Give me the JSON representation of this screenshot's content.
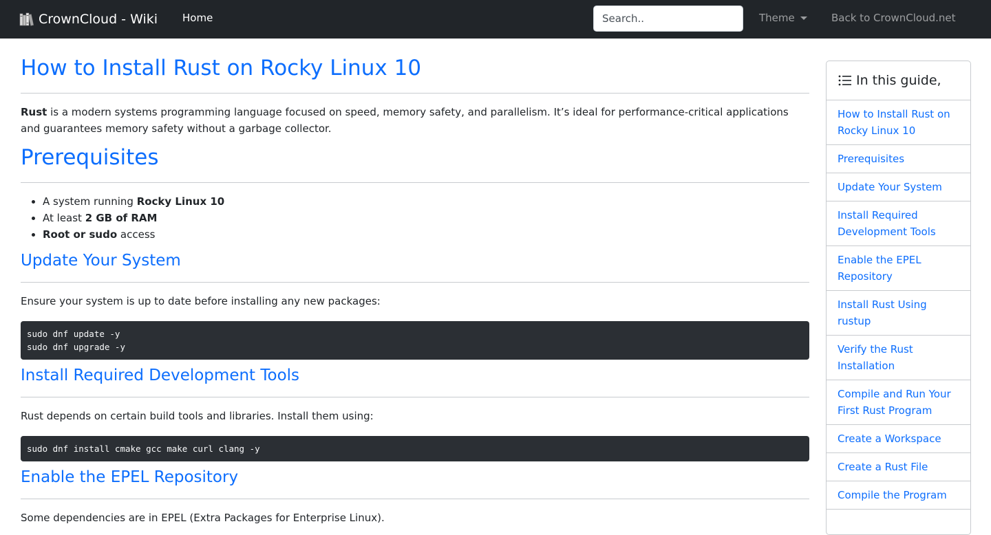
{
  "navbar": {
    "brand": "CrownCloud - Wiki",
    "home": "Home",
    "search_placeholder": "Search..",
    "theme": "Theme",
    "back": "Back to CrownCloud.net"
  },
  "article": {
    "title": "How to Install Rust on Rocky Linux 10",
    "intro_strong": "Rust",
    "intro_rest": " is a modern systems programming language focused on speed, memory safety, and parallelism. It’s ideal for performance-critical applications and guarantees memory safety without a garbage collector.",
    "prerequisites": {
      "heading": "Prerequisites",
      "items": [
        {
          "pre": "A system running ",
          "strong": "Rocky Linux 10",
          "post": ""
        },
        {
          "pre": "At least ",
          "strong": "2 GB of RAM",
          "post": ""
        },
        {
          "pre": "",
          "strong": "Root or sudo",
          "post": " access"
        }
      ]
    },
    "update": {
      "heading": "Update Your System",
      "text": "Ensure your system is up to date before installing any new packages:",
      "code": "sudo dnf update -y\nsudo dnf upgrade -y"
    },
    "devtools": {
      "heading": "Install Required Development Tools",
      "text": "Rust depends on certain build tools and libraries. Install them using:",
      "code": "sudo dnf install cmake gcc make curl clang -y"
    },
    "epel": {
      "heading": "Enable the EPEL Repository",
      "text": "Some dependencies are in EPEL (Extra Packages for Enterprise Linux)."
    }
  },
  "toc": {
    "header": "In this guide,",
    "items": [
      "How to Install Rust on Rocky Linux 10",
      "Prerequisites",
      "Update Your System",
      "Install Required Development Tools",
      "Enable the EPEL Repository",
      "Install Rust Using rustup",
      "Verify the Rust Installation",
      "Compile and Run Your First Rust Program",
      "Create a Workspace",
      "Create a Rust File",
      "Compile the Program"
    ]
  }
}
